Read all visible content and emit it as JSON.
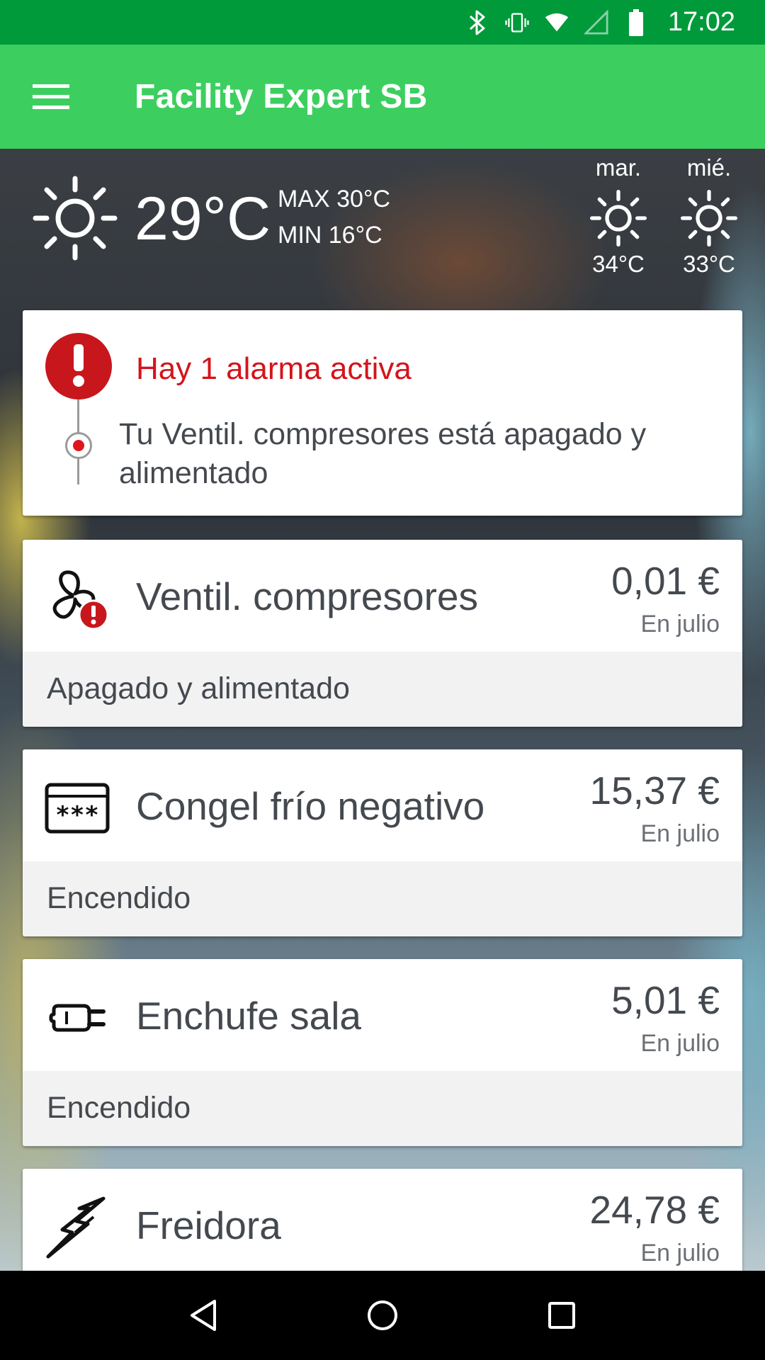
{
  "status_bar": {
    "time": "17:02",
    "icons": [
      "bluetooth-icon",
      "vibrate-icon",
      "wifi-icon",
      "signal-icon",
      "battery-icon"
    ]
  },
  "app_bar": {
    "title": "Facility Expert SB",
    "menu_icon": "hamburger-menu-icon"
  },
  "weather": {
    "icon": "sun-icon",
    "current_temp": "29°C",
    "max": "MAX 30°C",
    "min": "MIN 16°C",
    "forecast": [
      {
        "day": "mar.",
        "icon": "sun-icon",
        "temp": "34°C"
      },
      {
        "day": "mié.",
        "icon": "sun-icon",
        "temp": "33°C"
      }
    ]
  },
  "alarm": {
    "title": "Hay 1 alarma activa",
    "message": "Tu Ventil. compresores está apagado y alimentado",
    "color": "#d4141b"
  },
  "devices": [
    {
      "name": "Ventil. compresores",
      "icon": "fan-alert-icon",
      "cost": "0,01 €",
      "period": "En julio",
      "status": "Apagado y alimentado"
    },
    {
      "name": "Congel frío negativo",
      "icon": "freezer-icon",
      "cost": "15,37 €",
      "period": "En julio",
      "status": "Encendido"
    },
    {
      "name": "Enchufe sala",
      "icon": "plug-icon",
      "cost": "5,01 €",
      "period": "En julio",
      "status": "Encendido"
    },
    {
      "name": "Freidora",
      "icon": "lightning-icon",
      "cost": "24,78 €",
      "period": "En julio",
      "status": ""
    }
  ],
  "colors": {
    "status_bar": "#009a3a",
    "app_bar": "#3ccf5f",
    "alarm_red": "#c8161d"
  },
  "nav_bar": {
    "icons": [
      "back-icon",
      "home-icon",
      "recents-icon"
    ]
  }
}
